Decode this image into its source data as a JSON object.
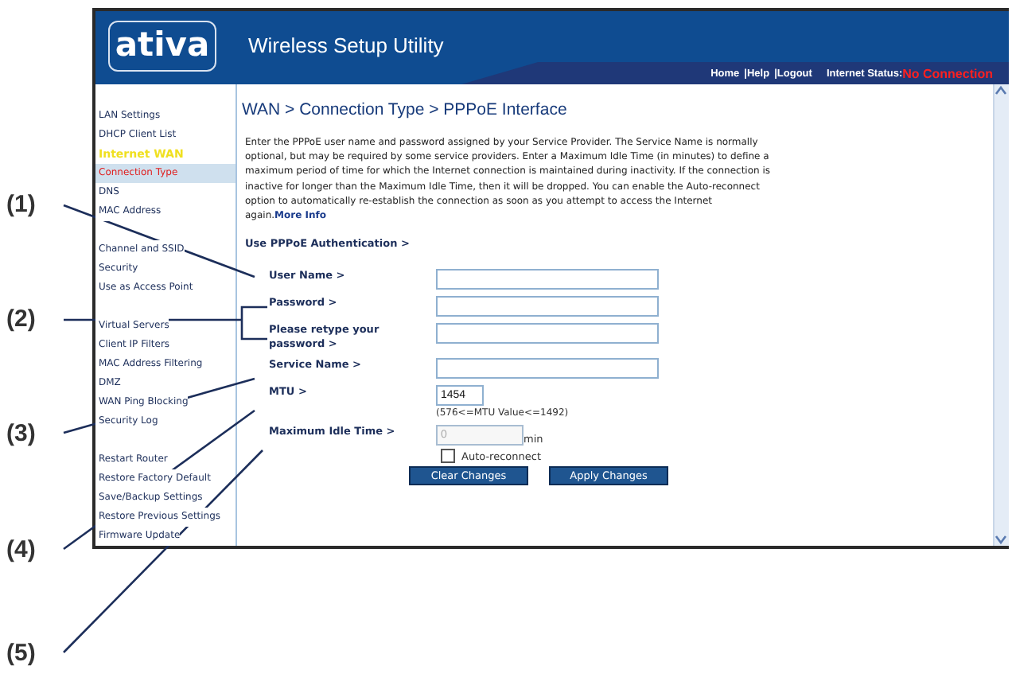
{
  "callouts": [
    {
      "label": "(1)"
    },
    {
      "label": "(2)"
    },
    {
      "label": "(3)"
    },
    {
      "label": "(4)"
    },
    {
      "label": "(5)"
    }
  ],
  "header": {
    "logo": "ativa",
    "title": "Wireless Setup Utility",
    "nav": [
      "Home",
      "Help",
      "Logout"
    ],
    "separator": "|",
    "status_label": "Internet Status:",
    "status_value": "No Connection"
  },
  "sidebar": {
    "groups": [
      {
        "items": [
          {
            "label": "LAN Settings",
            "kind": "link",
            "selected": false
          },
          {
            "label": "DHCP Client List",
            "kind": "link",
            "selected": false
          },
          {
            "label": "Internet WAN",
            "kind": "heading",
            "selected": false
          },
          {
            "label": "Connection Type",
            "kind": "link",
            "selected": true
          },
          {
            "label": "DNS",
            "kind": "link",
            "selected": false
          },
          {
            "label": "MAC Address",
            "kind": "link",
            "selected": false
          }
        ]
      },
      {
        "items": [
          {
            "label": "Channel and SSID",
            "kind": "link",
            "selected": false
          },
          {
            "label": "Security",
            "kind": "link",
            "selected": false
          },
          {
            "label": "Use as Access Point",
            "kind": "link",
            "selected": false
          }
        ]
      },
      {
        "items": [
          {
            "label": "Virtual Servers",
            "kind": "link",
            "selected": false
          },
          {
            "label": "Client IP Filters",
            "kind": "link",
            "selected": false
          },
          {
            "label": "MAC Address Filtering",
            "kind": "link",
            "selected": false
          },
          {
            "label": "DMZ",
            "kind": "link",
            "selected": false
          },
          {
            "label": "WAN Ping Blocking",
            "kind": "link",
            "selected": false
          },
          {
            "label": "Security Log",
            "kind": "link",
            "selected": false
          }
        ]
      },
      {
        "items": [
          {
            "label": "Restart Router",
            "kind": "link",
            "selected": false
          },
          {
            "label": "Restore Factory Default",
            "kind": "link",
            "selected": false
          },
          {
            "label": "Save/Backup Settings",
            "kind": "link",
            "selected": false
          },
          {
            "label": "Restore Previous Settings",
            "kind": "link",
            "selected": false
          },
          {
            "label": "Firmware Update",
            "kind": "link",
            "selected": false
          }
        ]
      }
    ]
  },
  "page": {
    "breadcrumb": "WAN > Connection Type > PPPoE Interface",
    "description": "Enter the PPPoE user name and password assigned by your Service Provider. The Service Name is normally optional, but may be required by some service providers.  Enter a Maximum Idle Time (in minutes) to define a maximum period of time for which the Internet connection is maintained during inactivity.  If the connection is inactive for longer than the Maximum Idle Time, then it will be dropped.  You can enable the Auto-reconnect option to automatically re-establish the connection as soon as you attempt to access the Internet again.",
    "more_info": "More Info",
    "section": "Use PPPoE Authentication >",
    "fields": [
      {
        "label": "User Name >",
        "kind": "text",
        "disabled": false
      },
      {
        "label": "Password >",
        "kind": "text",
        "disabled": false
      },
      {
        "label": "Please retype your password >",
        "kind": "text",
        "disabled": false
      },
      {
        "label": "Service Name >",
        "kind": "text",
        "disabled": false
      },
      {
        "label": "MTU >",
        "kind": "short",
        "value": "1454",
        "hint": "(576<=MTU Value<=1492)",
        "disabled": false
      },
      {
        "label": "Maximum Idle Time >",
        "kind": "unit",
        "value": "0",
        "unit": "min",
        "disabled": true
      }
    ],
    "checkbox": {
      "label": "Auto-reconnect",
      "checked": false
    },
    "buttons": [
      "Clear Changes",
      "Apply Changes"
    ]
  }
}
